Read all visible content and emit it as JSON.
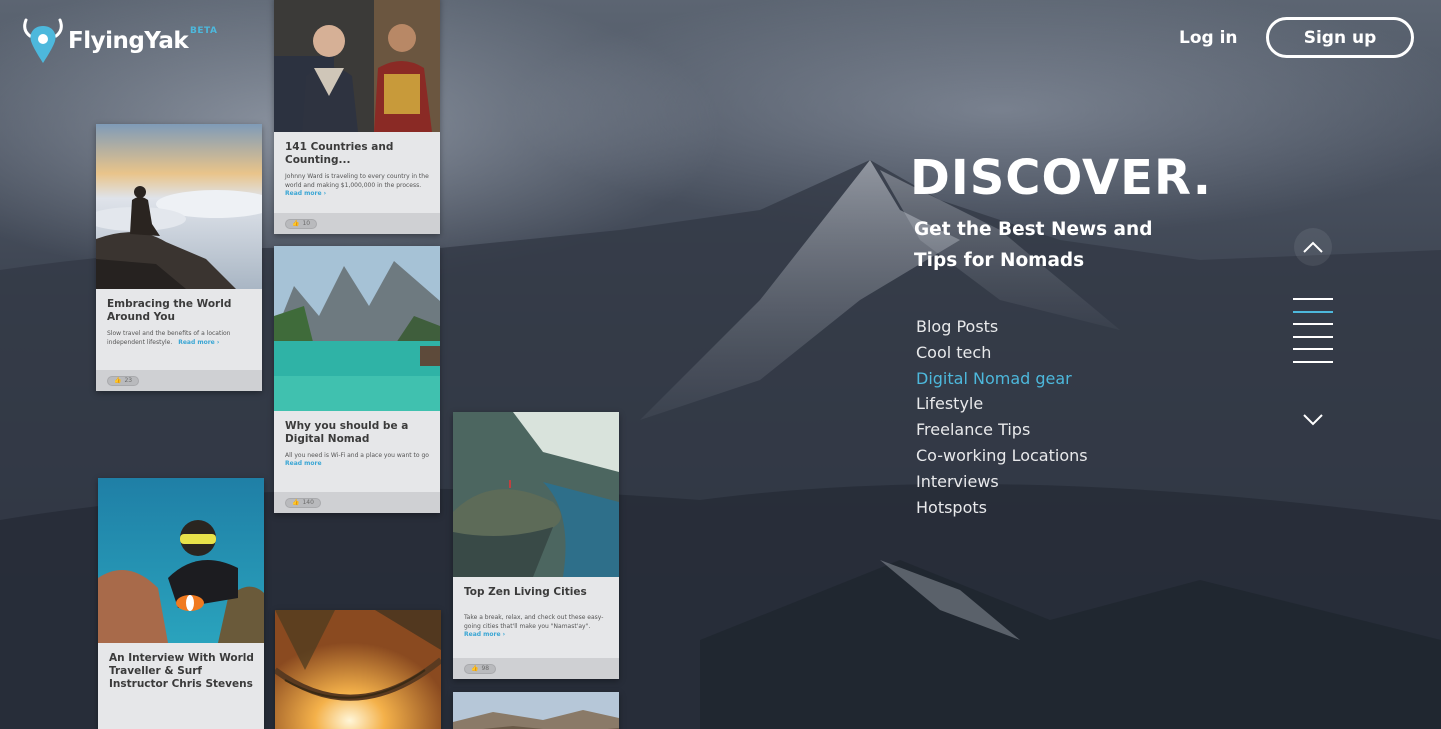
{
  "brand": {
    "name": "FlyingYak",
    "badge": "BETA"
  },
  "header": {
    "login_label": "Log in",
    "signup_label": "Sign up"
  },
  "hero": {
    "title": "DISCOVER.",
    "tagline": "Get the Best News and Tips for Nomads"
  },
  "categories": [
    {
      "label": "Blog Posts",
      "active": false
    },
    {
      "label": "Cool tech",
      "active": false
    },
    {
      "label": "Digital Nomad gear",
      "active": true
    },
    {
      "label": "Lifestyle",
      "active": false
    },
    {
      "label": "Freelance Tips",
      "active": false
    },
    {
      "label": "Co-working Locations",
      "active": false
    },
    {
      "label": "Interviews",
      "active": false
    },
    {
      "label": "Hotspots",
      "active": false
    }
  ],
  "cards": [
    {
      "title": "141 Countries and Counting...",
      "desc": "Johnny Ward is traveling to every country in the world and making $1,000,000 in the process.",
      "more": "Read more ›",
      "likes": "10"
    },
    {
      "title": "Embracing the World Around You",
      "desc": "Slow travel and the benefits of a location independent lifestyle.",
      "more": "Read more ›",
      "likes": "23"
    },
    {
      "title": "Why you should be a Digital Nomad",
      "desc": "All you need is Wi-Fi and a place you want to go",
      "more": "Read more",
      "likes": "140"
    },
    {
      "title": "Top Zen Living Cities",
      "desc": "Take a break, relax, and check out these easy-going cities that'll make you \"Namast'ay\".",
      "more": "Read more ›",
      "likes": "98"
    },
    {
      "title": "An Interview With World Traveller & Surf Instructor Chris Stevens",
      "desc": "",
      "more": "",
      "likes": ""
    }
  ],
  "slider": {
    "active_index": 0,
    "count": 6
  },
  "colors": {
    "accent": "#4db8dc",
    "text": "#ffffff",
    "card_bg": "#e6e7e9"
  },
  "icons": {
    "up": "chevron-up-icon",
    "down": "chevron-down-icon",
    "like": "thumbs-up-icon",
    "logo": "map-pin-horns-icon"
  }
}
